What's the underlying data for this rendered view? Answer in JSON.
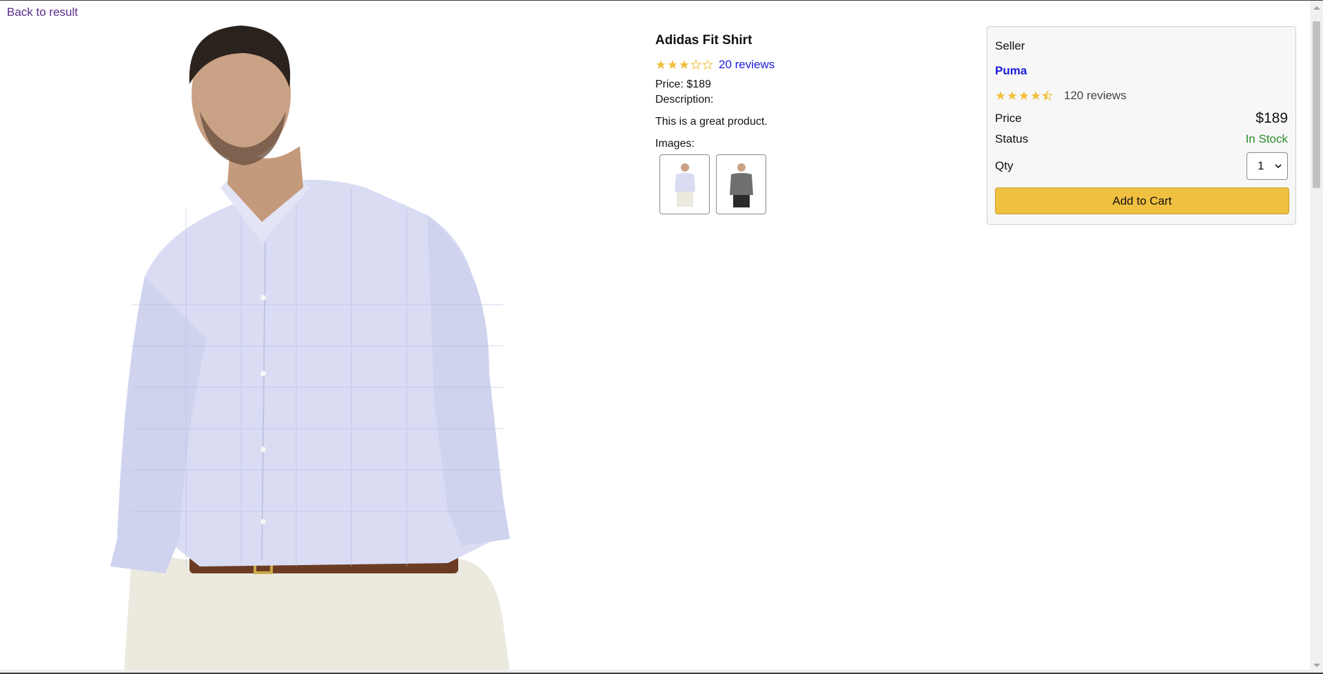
{
  "nav": {
    "back_label": "Back to result"
  },
  "product": {
    "name": "Adidas Fit Shirt",
    "rating": 3,
    "rating_max": 5,
    "reviews_label": "20 reviews",
    "price_line": "Price: $189",
    "description_label": "Description:",
    "description": "This is a great product.",
    "images_label": "Images:",
    "thumbnails": [
      "light-shirt-thumbnail",
      "grey-shirt-thumbnail"
    ]
  },
  "seller": {
    "label": "Seller",
    "name": "Puma",
    "rating": 4.5,
    "reviews_label": "120 reviews"
  },
  "purchase": {
    "price_label": "Price",
    "price_value": "$189",
    "status_label": "Status",
    "status_value": "In Stock",
    "qty_label": "Qty",
    "qty_value": "1",
    "add_to_cart_label": "Add to Cart"
  },
  "colors": {
    "star": "#f0c040",
    "link": "#1a1adb",
    "in_stock": "#2a8a2a",
    "button": "#f0c040"
  }
}
